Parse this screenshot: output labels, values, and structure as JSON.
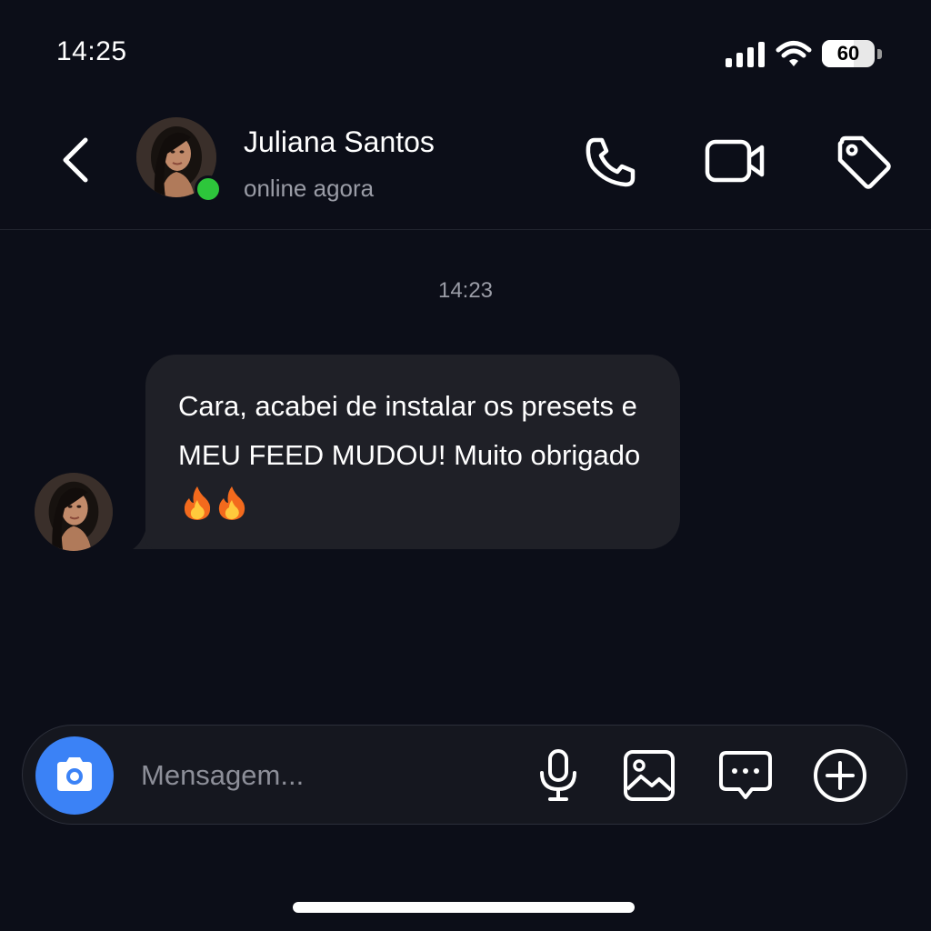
{
  "status_bar": {
    "time": "14:25",
    "battery_level": "60",
    "battery_fraction": 0.6
  },
  "header": {
    "contact_name": "Juliana Santos",
    "contact_status": "online agora",
    "online_color": "#2dc63b",
    "icons": [
      "back-icon",
      "phone-icon",
      "video-camera-icon",
      "tag-icon"
    ]
  },
  "conversation": {
    "timestamp": "14:23",
    "messages": [
      {
        "sender": "Juliana Santos",
        "direction": "incoming",
        "text": "Cara, acabei de instalar os presets e MEU FEED MUDOU! Muito obrigado",
        "emojis": [
          "🔥",
          "🔥"
        ]
      }
    ]
  },
  "composer": {
    "placeholder": "Mensagem...",
    "value": "",
    "accent_color": "#3b82f6",
    "icons": [
      "camera-icon",
      "microphone-icon",
      "image-icon",
      "sticker-message-icon",
      "add-icon"
    ]
  },
  "colors": {
    "background": "#0c0e18",
    "bubble": "#1f2027"
  }
}
